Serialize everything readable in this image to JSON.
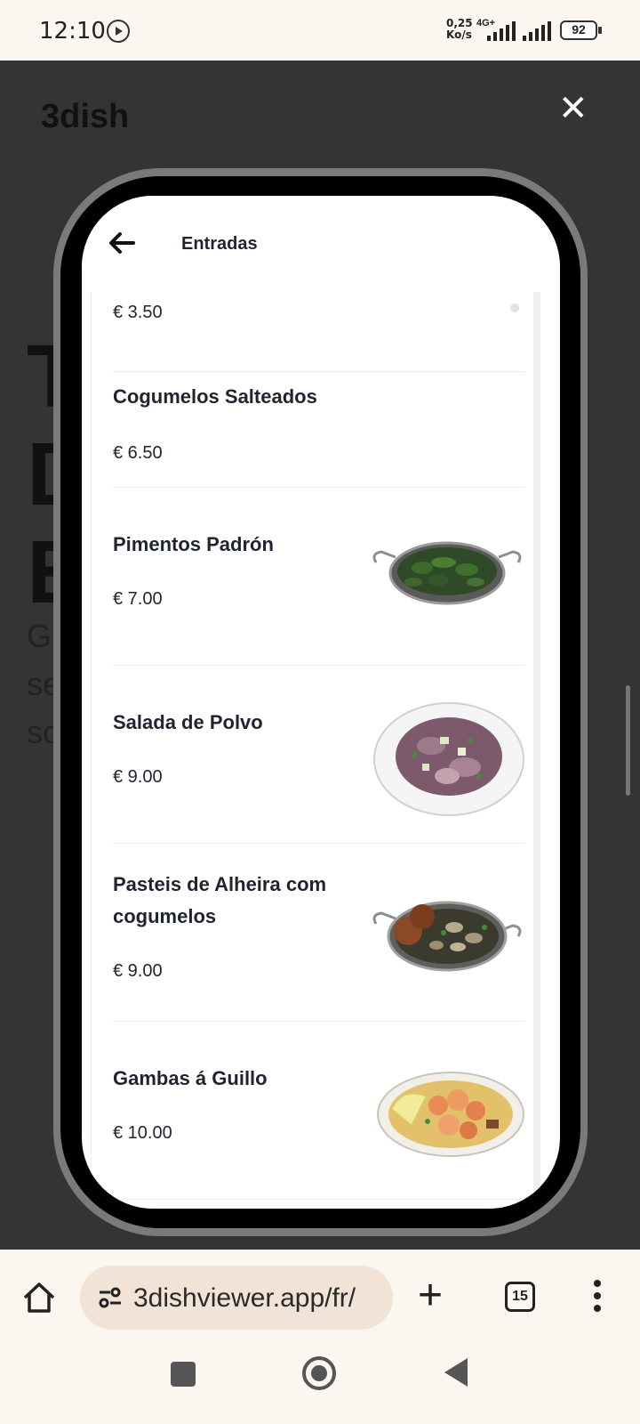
{
  "status_bar": {
    "time": "12:10",
    "net_rate_value": "0,25",
    "net_rate_unit": "Ko/s",
    "network_type": "4G+",
    "battery": "92"
  },
  "background_page": {
    "logo": "3dish",
    "big_letters": [
      "T",
      "D",
      "E"
    ],
    "small_letters": [
      "G",
      "se",
      "so"
    ]
  },
  "modal": {
    "header_title": "Entradas",
    "items": [
      {
        "name": "",
        "price": "€ 3.50",
        "image": "plate-partial"
      },
      {
        "name": "Cogumelos Salteados",
        "price": "€ 6.50",
        "image": ""
      },
      {
        "name": "Pimentos Padrón",
        "price": "€ 7.00",
        "image": "pan-green-peppers"
      },
      {
        "name": "Salada de Polvo",
        "price": "€ 9.00",
        "image": "bowl-octopus-salad"
      },
      {
        "name": "Pasteis de Alheira com cogumelos",
        "price": "€ 9.00",
        "image": "pan-croquettes-mushrooms"
      },
      {
        "name": "Gambas á Guillo",
        "price": "€ 10.00",
        "image": "bowl-prawns"
      }
    ]
  },
  "browser": {
    "url": "3dishviewer.app/fr/",
    "tab_count": "15"
  }
}
